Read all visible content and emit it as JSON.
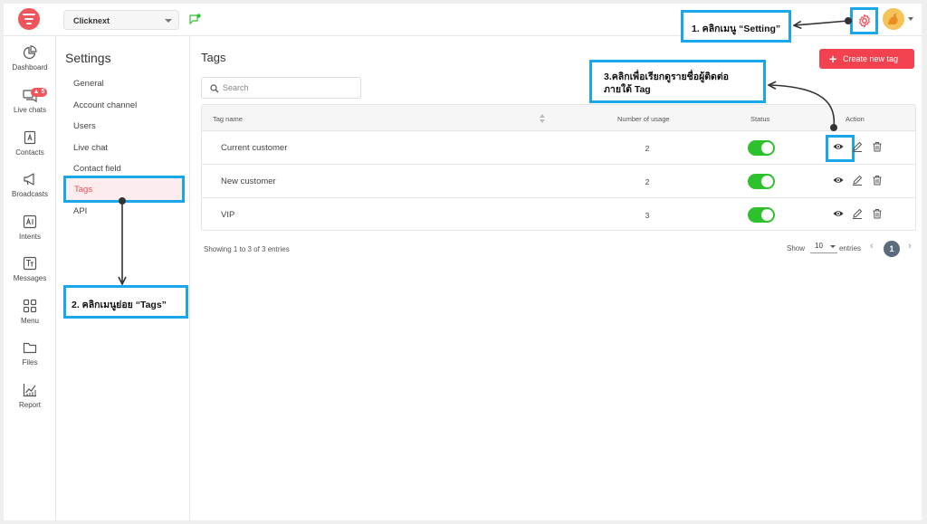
{
  "topbar": {
    "workspace": "Clicknext"
  },
  "nav": [
    {
      "label": "Dashboard",
      "icon": "pie-chart-icon"
    },
    {
      "label": "Live chats",
      "icon": "chat-bubbles-icon",
      "badge": "5"
    },
    {
      "label": "Contacts",
      "icon": "contact-card-icon"
    },
    {
      "label": "Broadcasts",
      "icon": "megaphone-icon"
    },
    {
      "label": "Intents",
      "icon": "ai-box-icon"
    },
    {
      "label": "Messages",
      "icon": "text-box-icon"
    },
    {
      "label": "Menu",
      "icon": "grid-icon"
    },
    {
      "label": "Files",
      "icon": "folder-icon"
    },
    {
      "label": "Report",
      "icon": "line-chart-icon"
    }
  ],
  "settings": {
    "title": "Settings",
    "items": [
      "General",
      "Account channel",
      "Users",
      "Live chat",
      "Contact field",
      "Tags",
      "API"
    ]
  },
  "main": {
    "title": "Tags",
    "create_label": "Create new tag",
    "search_placeholder": "Search",
    "columns": [
      "Tag name",
      "Number of usage",
      "Status",
      "Action"
    ],
    "rows": [
      {
        "name": "Current customer",
        "usage": "2",
        "status": true
      },
      {
        "name": "New customer",
        "usage": "2",
        "status": true
      },
      {
        "name": "VIP",
        "usage": "3",
        "status": true
      }
    ],
    "showing": "Showing 1 to 3 of 3 entries",
    "show_label": "Show",
    "page_size": "10",
    "entries_label": "entries",
    "current_page": "1"
  },
  "annotations": {
    "step1": "1. คลิกเมนู “Setting”",
    "step2": "2. คลิกเมนูย่อย “Tags”",
    "step3_line1": "3.คลิกเพื่อเรียกดูรายชื่อผู้ติดต่อ",
    "step3_line2": "ภายใต้ Tag"
  },
  "colors": {
    "accent": "#f2424f",
    "callout_border": "#1aa7ea",
    "toggle_on": "#2dc12d"
  }
}
